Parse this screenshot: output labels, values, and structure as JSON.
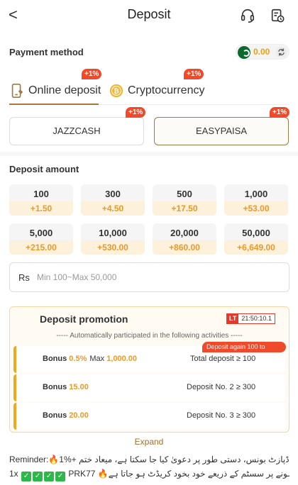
{
  "header": {
    "title": "Deposit",
    "back_glyph": "<",
    "icons": [
      "customer-support-icon",
      "deposit-records-icon"
    ]
  },
  "payment_method": {
    "title": "Payment method",
    "balance": "0.00",
    "tabs": [
      {
        "label": "Online deposit",
        "badge": "+1%",
        "icon": "phone-icon",
        "active": true
      },
      {
        "label": "Cryptocurrency",
        "badge": "+1%",
        "icon": "coin-icon",
        "active": false
      }
    ],
    "channels": [
      {
        "label": "JAZZCASH",
        "badge": "+1%",
        "selected": false
      },
      {
        "label": "EASYPAISA",
        "badge": "+1%",
        "selected": true
      }
    ]
  },
  "deposit_amount": {
    "title": "Deposit amount",
    "options": [
      {
        "amount": "100",
        "bonus": "+1.50"
      },
      {
        "amount": "300",
        "bonus": "+4.50"
      },
      {
        "amount": "500",
        "bonus": "+17.50"
      },
      {
        "amount": "1,000",
        "bonus": "+53.00"
      },
      {
        "amount": "5,000",
        "bonus": "+215.00"
      },
      {
        "amount": "10,000",
        "bonus": "+530.00"
      },
      {
        "amount": "20,000",
        "bonus": "+860.00"
      },
      {
        "amount": "50,000",
        "bonus": "+6,649.00"
      }
    ],
    "input": {
      "currency": "Rs",
      "placeholder": "Min 100~Max 50,000",
      "value": ""
    }
  },
  "promotion": {
    "title": "Deposit promotion",
    "timer_tag": "LT",
    "timer": "21:50:10.1",
    "auto_text": "----- Automatically participated in the following activities -----",
    "rows": [
      {
        "bonus_label": "Bonus",
        "bonus_value": "0.5%",
        "max_label": "Max",
        "max_value": "1,000.00",
        "condition": "Total deposit ≥ 100",
        "tag": "Deposit again 100 to receive"
      },
      {
        "bonus_label": "Bonus",
        "bonus_value": "15.00",
        "condition": "Deposit No. 2 ≥ 300"
      },
      {
        "bonus_label": "Bonus",
        "bonus_value": "20.00",
        "condition": "Deposit No. 3 ≥ 300"
      }
    ],
    "expand_label": "Expand"
  },
  "reminder": {
    "line1": "Reminder:🔥1%+ ڈپازٹ بونس، دستی طور پر دعویٰ کیا جا سکتا ہے، میعاد ختم",
    "line2_a": "1x",
    "line2_b": "PRKہونے پر سسٹم کے ذریعے خود بخود کریڈٹ ہو جاتا ہے🔥 77"
  },
  "colors": {
    "accent_gold": "#a67a3b",
    "badge_red": "#ef4a2b",
    "bonus_orange": "#e89a2b"
  }
}
